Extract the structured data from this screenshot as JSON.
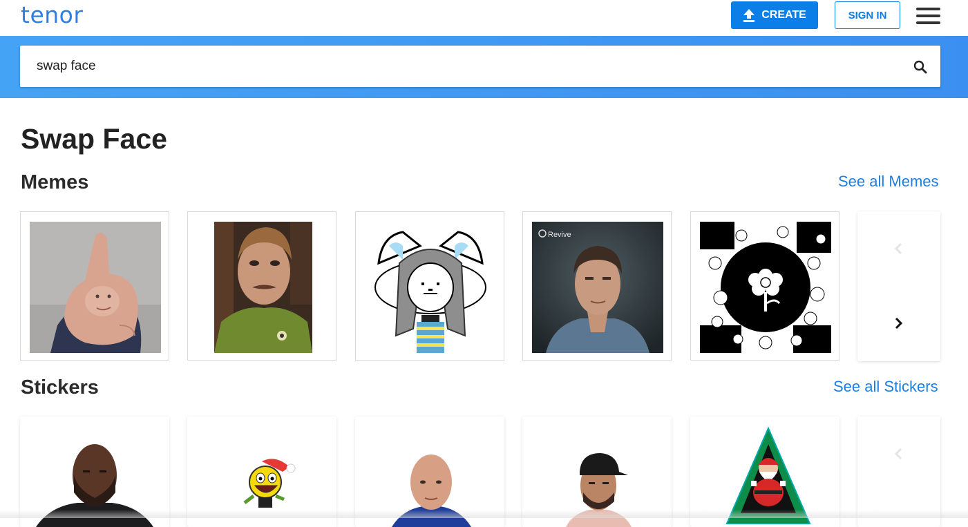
{
  "header": {
    "logo": "tenor",
    "create_label": "CREATE",
    "signin_label": "SIGN IN"
  },
  "search": {
    "value": "swap face"
  },
  "page": {
    "title": "Swap Face"
  },
  "sections": {
    "memes": {
      "title": "Memes",
      "see_all": "See all Memes"
    },
    "stickers": {
      "title": "Stickers",
      "see_all": "See all Stickers"
    }
  },
  "media_overlay": {
    "revive_label": "Revive"
  },
  "colors": {
    "brand_blue": "#0c7ee8",
    "search_band": "#3f97f2",
    "link_blue": "#1f7fe0"
  },
  "icons": {
    "create": "upload-arrow-icon",
    "search": "search-icon",
    "menu": "hamburger-icon",
    "prev": "chevron-left-icon",
    "next": "chevron-right-icon"
  }
}
